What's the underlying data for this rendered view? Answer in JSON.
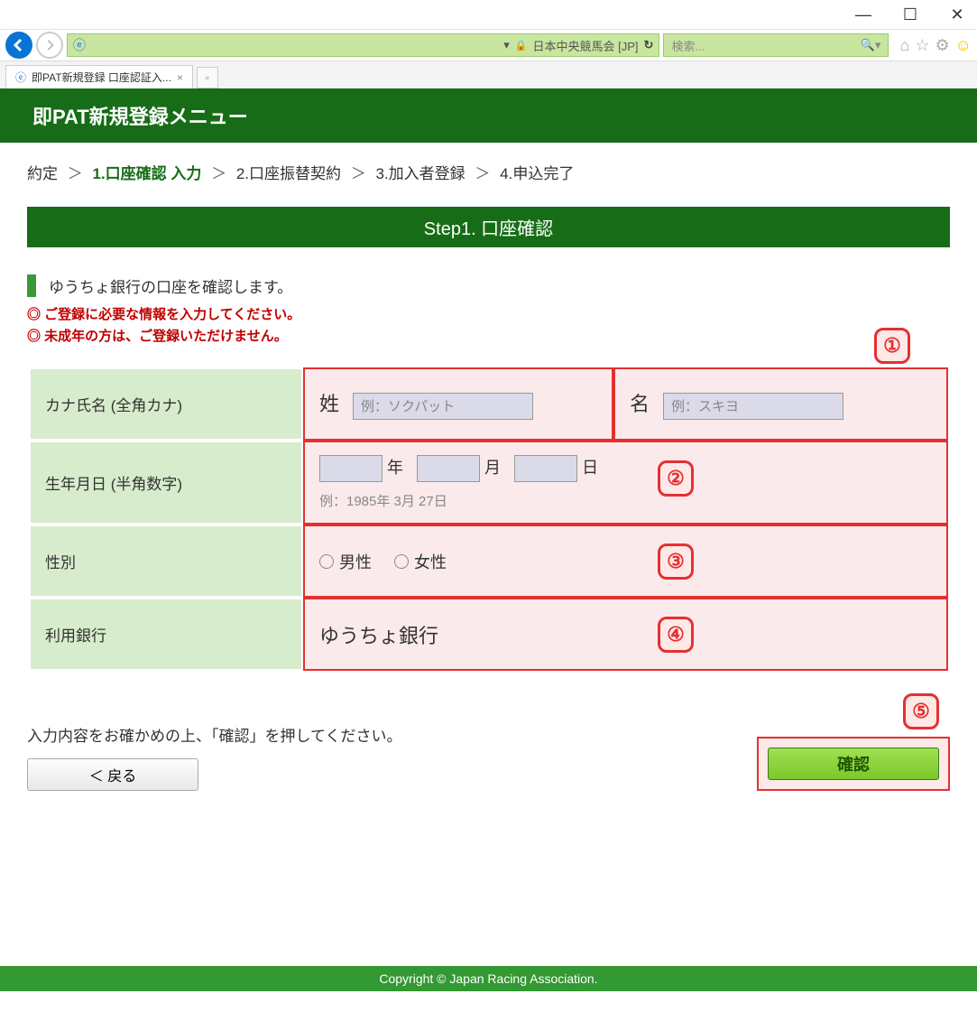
{
  "titlebar": {
    "minimize": "—",
    "maximize": "☐",
    "close": "✕"
  },
  "nav": {
    "site_label": "日本中央競馬会 [JP]",
    "search_placeholder": "検索..."
  },
  "tabs": {
    "active": "即PAT新規登録 口座認証入...",
    "close": "×"
  },
  "header": {
    "title": "即PAT新規登録メニュー"
  },
  "breadcrumb": {
    "b0": "約定",
    "b1": "1.口座確認 入力",
    "b2": "2.口座振替契約",
    "b3": "3.加入者登録",
    "b4": "4.申込完了",
    "sep": "＞"
  },
  "step": {
    "title": "Step1. 口座確認"
  },
  "lead": "ゆうちょ銀行の口座を確認します。",
  "alerts": {
    "a1": "◎ ご登録に必要な情報を入力してください。",
    "a2": "◎ 未成年の方は、ご登録いただけません。"
  },
  "form": {
    "name": {
      "label": "カナ氏名 (全角カナ)",
      "sei": "姓",
      "sei_ph": "例：ソクパット",
      "mei": "名",
      "mei_ph": "例：スキヨ"
    },
    "dob": {
      "label": "生年月日 (半角数字)",
      "y": "年",
      "m": "月",
      "d": "日",
      "hint": "例：1985年 3月 27日"
    },
    "sex": {
      "label": "性別",
      "male": "男性",
      "female": "女性"
    },
    "bank": {
      "label": "利用銀行",
      "value": "ゆうちょ銀行"
    }
  },
  "note": "入力内容をお確かめの上、「確認」を押してください。",
  "buttons": {
    "back": "＜ 戻る",
    "confirm": "確認"
  },
  "callouts": {
    "c1": "①",
    "c2": "②",
    "c3": "③",
    "c4": "④",
    "c5": "⑤"
  },
  "footer": "Copyright © Japan Racing Association."
}
